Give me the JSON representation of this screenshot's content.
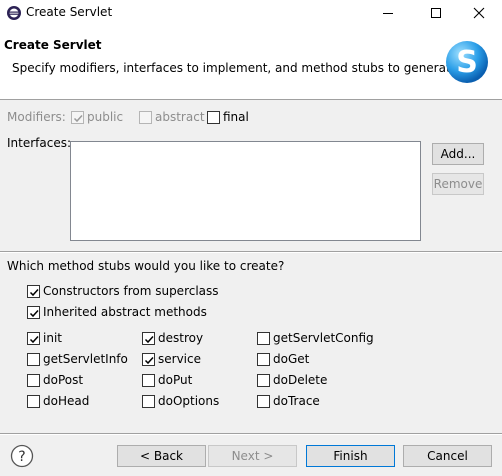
{
  "window": {
    "title": "Create Servlet"
  },
  "header": {
    "title": "Create Servlet",
    "description": "Specify modifiers, interfaces to implement, and method stubs to generate."
  },
  "modifiers": {
    "label": "Modifiers:",
    "public": {
      "label": "public",
      "checked": true,
      "enabled": false
    },
    "abstract": {
      "label": "abstract",
      "checked": false,
      "enabled": false
    },
    "final": {
      "label": "final",
      "checked": false,
      "enabled": true
    }
  },
  "interfaces": {
    "label": "Interfaces:",
    "items": [],
    "add_label": "Add...",
    "remove_label": "Remove"
  },
  "stubs": {
    "question": "Which method stubs would you like to create?",
    "constructors": {
      "label": "Constructors from superclass",
      "checked": true
    },
    "inherited": {
      "label": "Inherited abstract methods",
      "checked": true
    },
    "methods": [
      {
        "label": "init",
        "checked": true
      },
      {
        "label": "destroy",
        "checked": true
      },
      {
        "label": "getServletConfig",
        "checked": false
      },
      {
        "label": "getServletInfo",
        "checked": false
      },
      {
        "label": "service",
        "checked": true
      },
      {
        "label": "doGet",
        "checked": false
      },
      {
        "label": "doPost",
        "checked": false
      },
      {
        "label": "doPut",
        "checked": false
      },
      {
        "label": "doDelete",
        "checked": false
      },
      {
        "label": "doHead",
        "checked": false
      },
      {
        "label": "doOptions",
        "checked": false
      },
      {
        "label": "doTrace",
        "checked": false
      }
    ]
  },
  "footer": {
    "back_label": "< Back",
    "next_label": "Next >",
    "finish_label": "Finish",
    "cancel_label": "Cancel"
  },
  "icons": {
    "app": "eclipse-icon",
    "logo": "servlet-logo-icon",
    "help": "help-icon"
  }
}
